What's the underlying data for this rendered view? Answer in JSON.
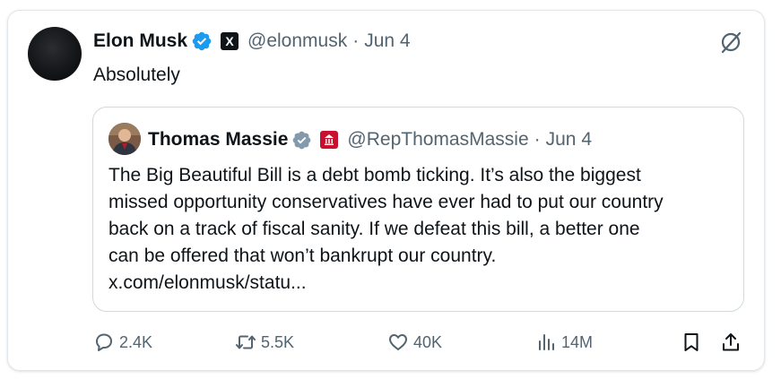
{
  "tweet": {
    "author_name": "Elon Musk",
    "author_handle": "@elonmusk",
    "separator": "·",
    "date": "Jun 4",
    "affiliation_badge": "X",
    "text": "Absolutely"
  },
  "quoted_tweet": {
    "author_name": "Thomas Massie",
    "author_handle": "@RepThomasMassie",
    "separator": "·",
    "date": "Jun 4",
    "lines": [
      "The Big Beautiful Bill is a debt bomb ticking. It’s also the biggest",
      "missed opportunity conservatives have ever had to put our country",
      "back on a track of fiscal sanity. If we defeat this bill, a better one",
      "can be offered that won’t bankrupt our country."
    ],
    "link": "x.com/elonmusk/statu..."
  },
  "actions": {
    "reply_count": "2.4K",
    "repost_count": "5.5K",
    "like_count": "40K",
    "view_count": "14M"
  },
  "colors": {
    "verified_blue": "#1d9bf0",
    "verified_gray": "#829aab",
    "muted_text": "#536471",
    "house_badge_red": "#c8102e"
  },
  "icons": [
    "verified-badge-icon",
    "x-logo-icon",
    "grok-icon",
    "government-verified-badge-icon",
    "house-seal-icon",
    "reply-icon",
    "repost-icon",
    "like-icon",
    "views-icon",
    "bookmark-icon",
    "share-icon"
  ]
}
